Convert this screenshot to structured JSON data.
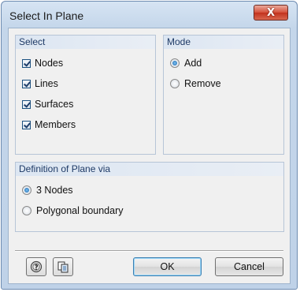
{
  "window": {
    "title": "Select In Plane",
    "close_label": "X"
  },
  "select_group": {
    "header": "Select",
    "items": [
      {
        "label": "Nodes",
        "checked": true
      },
      {
        "label": "Lines",
        "checked": true
      },
      {
        "label": "Surfaces",
        "checked": true
      },
      {
        "label": "Members",
        "checked": true
      }
    ]
  },
  "mode_group": {
    "header": "Mode",
    "options": [
      {
        "label": "Add",
        "selected": true
      },
      {
        "label": "Remove",
        "selected": false
      }
    ]
  },
  "plane_group": {
    "header": "Definition of Plane via",
    "options": [
      {
        "label": "3 Nodes",
        "selected": true
      },
      {
        "label": "Polygonal boundary",
        "selected": false
      }
    ]
  },
  "footer": {
    "icons": [
      "help-icon",
      "copy-icon"
    ],
    "ok_label": "OK",
    "cancel_label": "Cancel"
  }
}
